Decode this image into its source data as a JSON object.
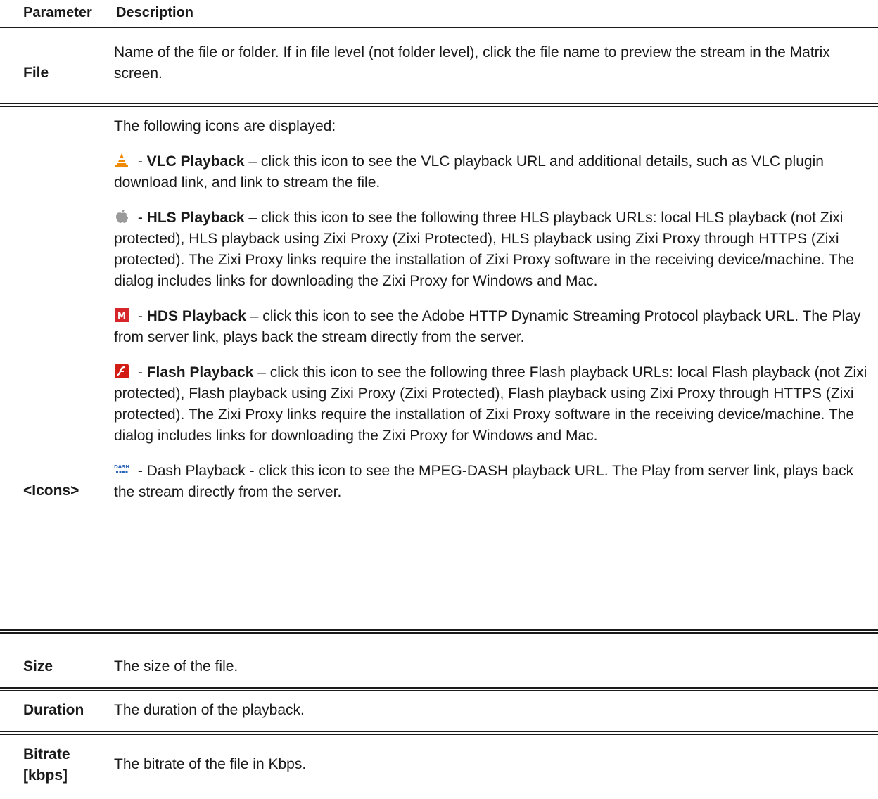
{
  "header": {
    "parameter": "Parameter",
    "description": "Description"
  },
  "rows": {
    "file": {
      "param": "File",
      "desc": "Name of the file or folder. If in file level (not folder level), click the file name to preview the stream in the Matrix screen."
    },
    "icons": {
      "param": "<Icons>",
      "intro": "The following icons are displayed:",
      "vlc": {
        "icon": "vlc-cone-icon",
        "dash_prefix": " - ",
        "name": "VLC Playback",
        "text": " – click this icon to see the VLC playback URL and additional details, such as VLC plugin download link, and link to stream the file."
      },
      "hls": {
        "icon": "apple-icon",
        "dash_prefix": " - ",
        "name": "HLS Playback",
        "text": " – click this icon to see the following three HLS playback URLs: local HLS playback (not Zixi protected), HLS playback using Zixi Proxy (Zixi Protected), HLS playback using Zixi Proxy through HTTPS (Zixi protected). The Zixi Proxy links require the installation of Zixi Proxy software in the receiving device/machine. The dialog includes links for downloading the Zixi Proxy for Windows and Mac."
      },
      "hds": {
        "icon": "hds-icon",
        "dash_prefix": " - ",
        "name": "HDS Playback",
        "text": " – click this icon to see the Adobe HTTP Dynamic Streaming Protocol playback URL. The Play from server link, plays back the stream directly from the server."
      },
      "flash": {
        "icon": "flash-icon",
        "dash_prefix": " - ",
        "name": "Flash Playback",
        "text": " – click this icon to see the following three Flash playback URLs: local Flash playback (not Zixi protected), Flash playback using Zixi Proxy (Zixi Protected), Flash playback using Zixi Proxy through HTTPS (Zixi protected). The Zixi Proxy links require the installation of Zixi Proxy software in the receiving device/machine. The dialog includes links for downloading the Zixi Proxy for Windows and Mac."
      },
      "dash": {
        "icon": "dash-icon",
        "icon_text": "DASH",
        "text": " - Dash Playback - click this icon to see the MPEG-DASH playback URL. The Play from server link, plays back the stream directly from the server."
      }
    },
    "size": {
      "param": "Size",
      "desc": "The size of the file."
    },
    "duration": {
      "param": "Duration",
      "desc": "The duration of the playback."
    },
    "bitrate": {
      "param_line1": "Bitrate",
      "param_line2": "[kbps]",
      "desc": "The bitrate of the file in Kbps."
    }
  },
  "colors": {
    "text": "#1a1a1a",
    "vlc": "#f08a00",
    "hds": "#d7262b",
    "flash": "#d21d14",
    "dash": "#2a66b8"
  }
}
